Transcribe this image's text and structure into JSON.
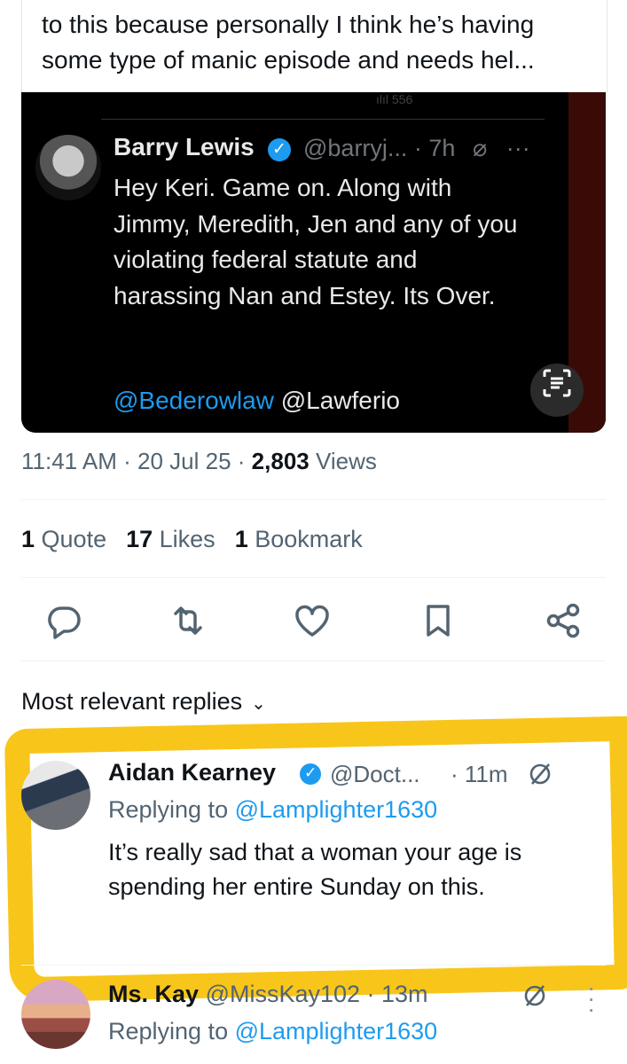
{
  "quoted_post": {
    "text": "to this because personally I think he’s having some type of manic episode and needs hel..."
  },
  "embedded_screenshot": {
    "author_name": "Barry Lewis",
    "author_handle": "@barryj... · 7h",
    "more_label": "···",
    "text": "Hey Keri. Game on. Along with Jimmy, Meredith, Jen and any of you violating federal statute and harassing Nan and Estey. Its Over.",
    "mention_1": "@Bederowlaw",
    "mention_2": "@Lawferio",
    "top_fragment": "ılıl 556"
  },
  "post_meta": {
    "time": "11:41 AM · 20 Jul 25 · ",
    "views_count": "2,803",
    "views_label": " Views"
  },
  "stats": {
    "quotes_count": "1",
    "quotes_label": " Quote",
    "likes_count": "17",
    "likes_label": " Likes",
    "bookmarks_count": "1",
    "bookmarks_label": " Bookmark"
  },
  "actions": [
    "reply-icon",
    "repost-icon",
    "like-icon",
    "bookmark-icon",
    "share-icon"
  ],
  "replies_header": "Most relevant replies",
  "replies": [
    {
      "name": "Aidan Kearney",
      "handle": "@Doct...",
      "time": "· 11m",
      "replying_label": "Replying to ",
      "replying_to": "@Lamplighter1630",
      "text": "It’s really sad that a woman your age is spending her entire Sunday on this."
    },
    {
      "name": "Ms. Kay",
      "handle": "@MissKay102 · 13m",
      "replying_label": "Replying to ",
      "replying_to": "@Lamplighter1630"
    }
  ],
  "colors": {
    "accent": "#1d9bf0",
    "highlight": "#f8c61a",
    "text_secondary": "#536471"
  }
}
